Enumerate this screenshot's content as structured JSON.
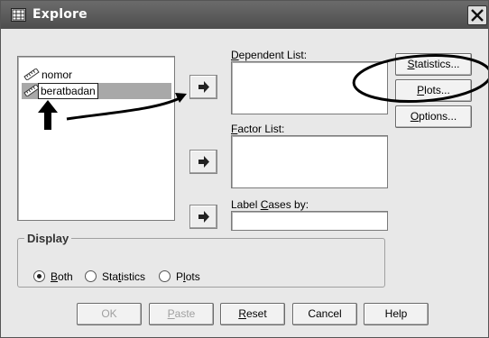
{
  "window": {
    "title": "Explore"
  },
  "source_list": {
    "items": [
      {
        "label": "nomor",
        "selected": false
      },
      {
        "label": "beratbadan",
        "selected": true
      }
    ]
  },
  "dependent_list": {
    "label_pre": "",
    "label_mnemonic": "D",
    "label_post": "ependent List:"
  },
  "factor_list": {
    "label_pre": "",
    "label_mnemonic": "F",
    "label_post": "actor List:"
  },
  "label_cases": {
    "label_pre": "Label ",
    "label_mnemonic": "C",
    "label_post": "ases by:"
  },
  "side_buttons": {
    "statistics": {
      "pre": "",
      "mn": "S",
      "post": "tatistics..."
    },
    "plots": {
      "pre": "",
      "mn": "P",
      "post": "lots..."
    },
    "options": {
      "pre": "",
      "mn": "O",
      "post": "ptions..."
    }
  },
  "display": {
    "legend": "Display",
    "options": [
      {
        "pre": "",
        "mn": "B",
        "post": "oth",
        "checked": true
      },
      {
        "pre": "Sta",
        "mn": "t",
        "post": "istics",
        "checked": false
      },
      {
        "pre": "P",
        "mn": "l",
        "post": "ots",
        "checked": false
      }
    ]
  },
  "bottom_buttons": {
    "ok": {
      "pre": "OK",
      "mn": "",
      "post": "",
      "enabled": false
    },
    "paste": {
      "pre": "",
      "mn": "P",
      "post": "aste",
      "enabled": false
    },
    "reset": {
      "pre": "",
      "mn": "R",
      "post": "eset",
      "enabled": true
    },
    "cancel": {
      "pre": "Cancel",
      "mn": "",
      "post": "",
      "enabled": true
    },
    "help": {
      "pre": "Help",
      "mn": "",
      "post": "",
      "enabled": true
    }
  },
  "colors": {
    "titlebar": "#555555",
    "dialog_bg": "#e8e8e8",
    "annotation": "#000000"
  }
}
